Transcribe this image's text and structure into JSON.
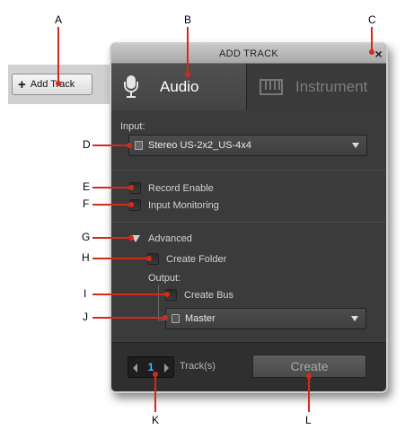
{
  "callouts": {
    "a": "A",
    "b": "B",
    "c": "C",
    "d": "D",
    "e": "E",
    "f": "F",
    "g": "G",
    "h": "H",
    "i": "I",
    "j": "J",
    "k": "K",
    "l": "L"
  },
  "add_track_button": {
    "icon": "plus-icon",
    "label": "Add Track"
  },
  "dialog": {
    "title": "ADD TRACK",
    "close_label": "×",
    "tabs": [
      {
        "label": "Audio",
        "icon": "microphone-icon",
        "selected": true
      },
      {
        "label": "Instrument",
        "icon": "piano-keyboard-icon",
        "selected": false
      }
    ],
    "input": {
      "label": "Input:",
      "value": "Stereo US-2x2_US-4x4"
    },
    "record_enable": {
      "label": "Record Enable",
      "checked": false
    },
    "input_monitoring": {
      "label": "Input Monitoring",
      "checked": false
    },
    "advanced": {
      "label": "Advanced",
      "expanded": true,
      "create_folder": {
        "label": "Create Folder",
        "checked": false
      },
      "output": {
        "label": "Output:",
        "create_bus": {
          "label": "Create Bus",
          "checked": false
        },
        "value": "Master"
      }
    },
    "footer": {
      "track_count": "1",
      "tracks_label": "Track(s)",
      "create_label": "Create"
    }
  },
  "colors": {
    "callout_line": "#d42a1e",
    "dialog_bg": "#3b3b3c",
    "track_count": "#49b8ff"
  }
}
